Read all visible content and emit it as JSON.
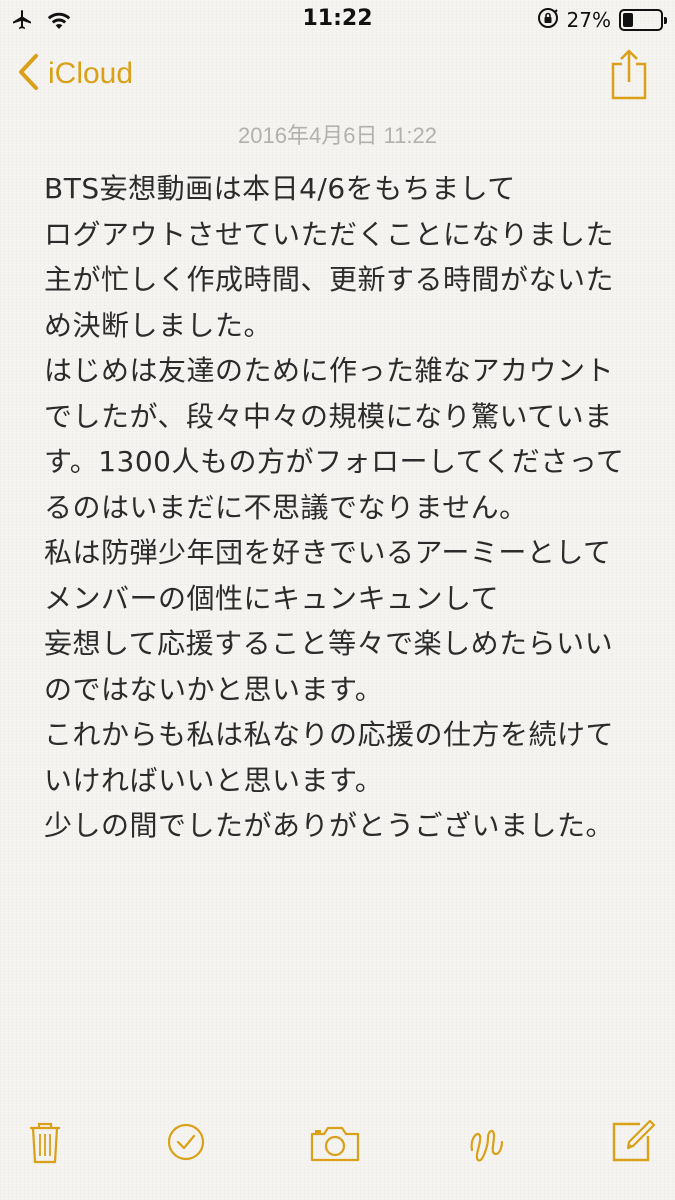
{
  "status_bar": {
    "time": "11:22",
    "battery_percent": "27%",
    "battery_level": 0.27,
    "icons": [
      "airplane-icon",
      "wifi-icon",
      "orientation-lock-icon",
      "battery-icon"
    ]
  },
  "nav": {
    "back_label": "iCloud",
    "accent_color": "#d9a018"
  },
  "note": {
    "date": "2016年4月6日 11:22",
    "lines": [
      "BTS妄想動画は本日4/6をもちまして",
      "ログアウトさせていただくことになりました",
      "主が忙しく作成時間、更新する時間がないた",
      "め決断しました。",
      "はじめは友達のために作った雑なアカウント",
      "でしたが、段々中々の規模になり驚いていま",
      "す。1300人もの方がフォローしてくださって",
      "るのはいまだに不思議でなりません。",
      "私は防弾少年団を好きでいるアーミーとして",
      "メンバーの個性にキュンキュンして",
      "妄想して応援すること等々で楽しめたらいい",
      "のではないかと思います。",
      "これからも私は私なりの応援の仕方を続けて",
      "いければいいと思います。",
      "少しの間でしたがありがとうございました。"
    ]
  },
  "toolbar": {
    "icons": [
      "trash-icon",
      "checklist-icon",
      "camera-icon",
      "sketch-icon",
      "compose-icon"
    ]
  }
}
